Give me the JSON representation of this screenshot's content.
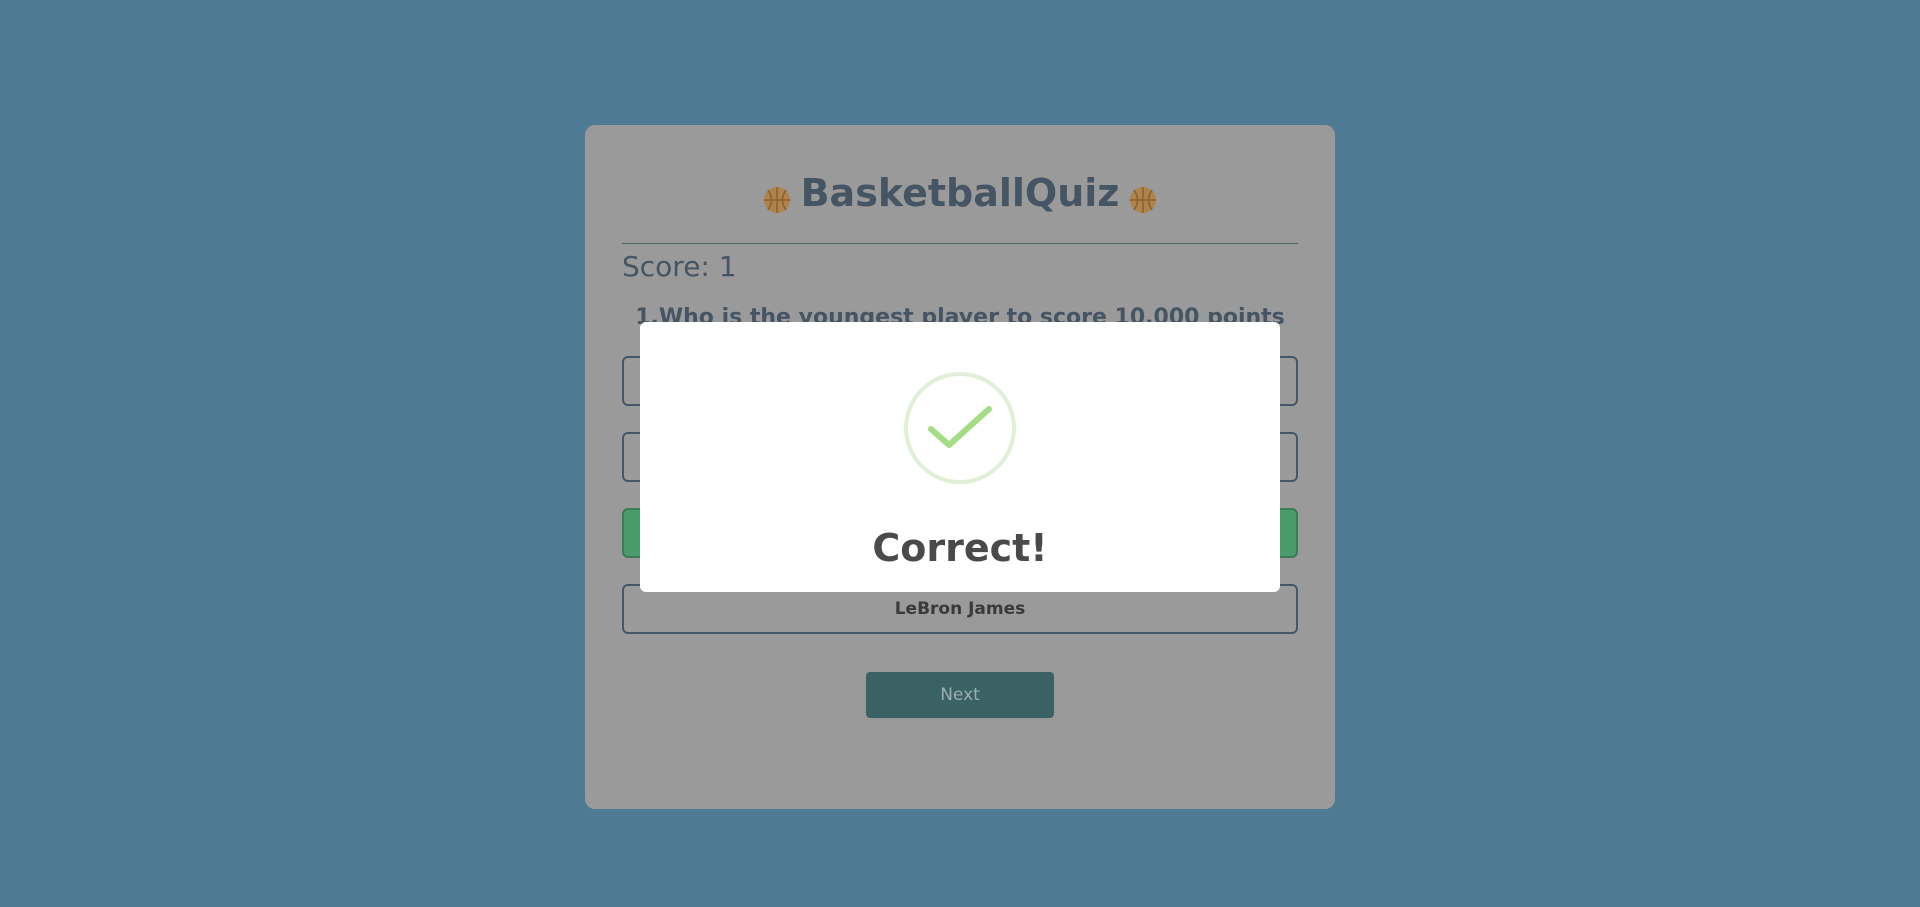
{
  "quiz": {
    "title": "BasketballQuiz",
    "title_icon": "basketball-icon",
    "score_text": "Score: 1",
    "question": "1.Who is the youngest player to score 10,000 points in the NBA?",
    "answers": [
      {
        "label": "",
        "state": "neutral"
      },
      {
        "label": "",
        "state": "neutral"
      },
      {
        "label": "",
        "state": "correct"
      },
      {
        "label": "LeBron James",
        "state": "neutral"
      }
    ],
    "next_label": "Next"
  },
  "modal": {
    "icon": "checkmark-icon",
    "title": "Correct!"
  },
  "colors": {
    "background": "#4e7a94",
    "card": "#9a9a9a",
    "correct": "#4a9b6a",
    "next_button": "#3a6264",
    "ball": "#b0834a",
    "check": "#a5dc86"
  }
}
